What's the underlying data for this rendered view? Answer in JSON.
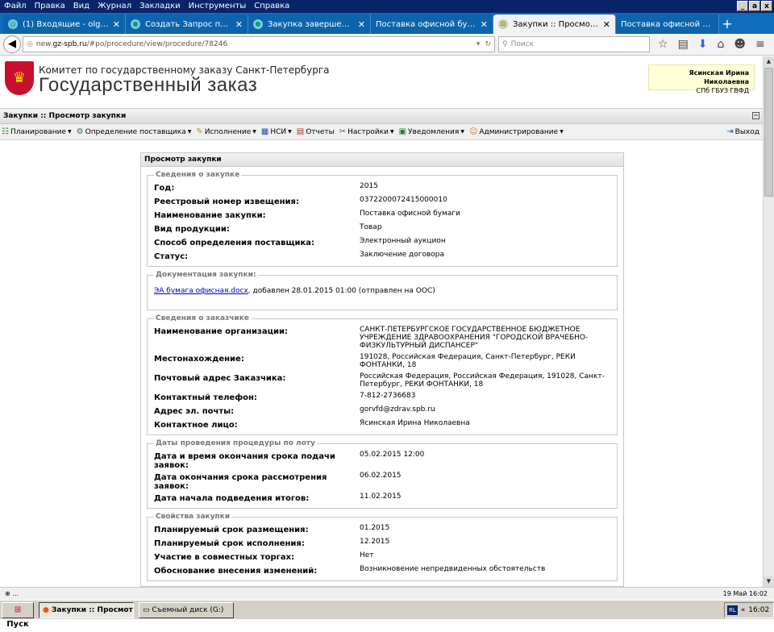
{
  "os": {
    "menu": [
      "Файл",
      "Правка",
      "Вид",
      "Журнал",
      "Закладки",
      "Инструменты",
      "Справка"
    ],
    "window_controls": [
      "_",
      "a",
      "x"
    ]
  },
  "tabs": [
    {
      "label": "(1) Входящие - olg1012@m...",
      "close": "✕"
    },
    {
      "label": "Создать Запрос поддерж...",
      "close": "✕"
    },
    {
      "label": "Закупка завершена, а нах...",
      "close": "✕"
    },
    {
      "label": "Поставка офисной бумаги",
      "close": "✕"
    },
    {
      "label": "Закупки :: Просмотр заку...",
      "close": "✕"
    },
    {
      "label": "Поставка офисной бумаги",
      "close": ""
    }
  ],
  "active_tab_index": 4,
  "nav": {
    "url_prefix": "new.",
    "url_domain": "gz-spb.ru",
    "url_path": "/#po/procedure/view/procedure/78246",
    "search_placeholder": "Поиск"
  },
  "site": {
    "org_name": "Комитет по государственному заказу Санкт-Петербурга",
    "title": "Государственный заказ",
    "user_name": "Ясинская Ирина Николаевна",
    "user_org": "СПб ГБУЗ ГВФД"
  },
  "page_bar": {
    "title": "Закупки :: Просмотр закупки"
  },
  "toolbar": [
    "Планирование",
    "Определение поставщика",
    "Исполнение",
    "НСИ",
    "Отчеты",
    "Настройки",
    "Уведомления",
    "Администрирование"
  ],
  "toolbar_exit": "Выход",
  "panel": {
    "title": "Просмотр закупки",
    "sections": [
      {
        "legend": "Сведения о закупке",
        "rows": [
          {
            "label": "Год:",
            "value": "2015"
          },
          {
            "label": "Реестровый номер извещения:",
            "value": "0372200072415000010"
          },
          {
            "label": "Наименование закупки:",
            "value": "Поставка офисной бумаги"
          },
          {
            "label": "Вид продукции:",
            "value": "Товар"
          },
          {
            "label": "Способ определения поставщика:",
            "value": "Электронный аукцион"
          },
          {
            "label": "Статус:",
            "value": "Заключение договора"
          }
        ]
      },
      {
        "legend": "Документация закупки:",
        "doc_link": "ЭА бумага офисная.docx",
        "doc_rest": ", добавлен 28.01.2015 01:00 (отправлен на ООС)"
      },
      {
        "legend": "Сведения о заказчике",
        "rows": [
          {
            "label": "Наименование организации:",
            "value": "САНКТ-ПЕТЕРБУРГСКОЕ ГОСУДАРСТВЕННОЕ БЮДЖЕТНОЕ УЧРЕЖДЕНИЕ ЗДРАВООХРАНЕНИЯ \"ГОРОДСКОЙ ВРАЧЕБНО-ФИЗКУЛЬТУРНЫЙ ДИСПАНСЕР\""
          },
          {
            "label": "Местонахождение:",
            "value": "191028, Российская Федерация, Санкт-Петербург, РЕКИ ФОНТАНКИ, 18"
          },
          {
            "label": "Почтовый адрес Заказчика:",
            "value": "Российская Федерация, Российская Федерация, 191028, Санкт-Петербург, РЕКИ ФОНТАНКИ, 18"
          },
          {
            "label": "Контактный телефон:",
            "value": "7-812-2736683"
          },
          {
            "label": "Адрес эл. почты:",
            "value": "gorvfd@zdrav.spb.ru"
          },
          {
            "label": "Контактное лицо:",
            "value": "Ясинская Ирина Николаевна"
          }
        ]
      },
      {
        "legend": "Даты проведения процедуры по лоту",
        "rows": [
          {
            "label": "Дата и время окончания срока подачи заявок:",
            "value": "05.02.2015 12:00"
          },
          {
            "label": "Дата окончания срока рассмотрения заявок:",
            "value": "06.02.2015"
          },
          {
            "label": "Дата начала подведения итогов:",
            "value": "11.02.2015"
          }
        ]
      },
      {
        "legend": "Свойства закупки",
        "rows": [
          {
            "label": "Планируемый срок размещения:",
            "value": "01.2015"
          },
          {
            "label": "Планируемый срок исполнения:",
            "value": "12.2015"
          },
          {
            "label": "Участие в совместных торгах:",
            "value": "Нет"
          },
          {
            "label": "Обоснование внесения изменений:",
            "value": "Возникновение непредвиденных обстоятельств"
          }
        ]
      }
    ]
  },
  "statusbar": {
    "left": "⊕ ...",
    "right": "19 Май 16:02"
  },
  "taskbar": {
    "start": "Пуск",
    "tasks": [
      "Закупки :: Просмотр ...",
      "Съемный диск (G:)"
    ],
    "lang": "RL",
    "arrows": "«",
    "clock": "16:02"
  }
}
